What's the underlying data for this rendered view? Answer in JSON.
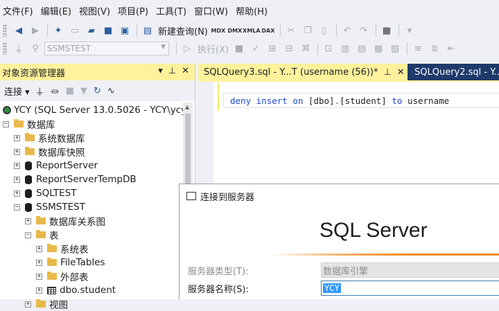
{
  "menubar": {
    "items": [
      "文件(F)",
      "编辑(E)",
      "视图(V)",
      "项目(P)",
      "工具(T)",
      "窗口(W)",
      "帮助(H)"
    ]
  },
  "toolbar": {
    "new_query_label": "新建查询(N)",
    "small_buttons": [
      "MDX",
      "DMX",
      "XMLA",
      "DAX"
    ],
    "database_combo_value": "SSMSTEST",
    "execute_label": "执行(X)"
  },
  "object_explorer": {
    "title": "对象资源管理器",
    "connect_label": "连接",
    "server_node": "YCY (SQL Server 13.0.5026 - YCY\\ycy",
    "databases_node": "数据库",
    "nodes": [
      {
        "label": "系统数据库",
        "icon": "folder-icon"
      },
      {
        "label": "数据库快照",
        "icon": "folder-icon"
      },
      {
        "label": "ReportServer",
        "icon": "database-icon"
      },
      {
        "label": "ReportServerTempDB",
        "icon": "database-icon"
      },
      {
        "label": "SQLTEST",
        "icon": "database-icon"
      },
      {
        "label": "SSMSTEST",
        "icon": "database-icon"
      },
      {
        "label": "数据库关系图",
        "icon": "folder-icon"
      },
      {
        "label": "表",
        "icon": "folder-icon"
      },
      {
        "label": "系统表",
        "icon": "folder-icon"
      },
      {
        "label": "FileTables",
        "icon": "folder-icon"
      },
      {
        "label": "外部表",
        "icon": "folder-icon"
      },
      {
        "label": "dbo.student",
        "icon": "table-icon"
      },
      {
        "label": "视图",
        "icon": "folder-icon"
      }
    ]
  },
  "editor": {
    "tabs": [
      {
        "label": "SQLQuery3.sql - Y...T (username (56))*",
        "active": true
      },
      {
        "label": "SQLQuery2.sql - Y...",
        "active": false
      }
    ],
    "code": {
      "kw1": "deny",
      "kw2": "insert",
      "kw3": "on",
      "obj1": "[dbo]",
      "dot": ".",
      "obj2": "[student]",
      "kw4": "to",
      "user": "username"
    }
  },
  "connect_dialog": {
    "title": "连接到服务器",
    "product": "SQL Server",
    "server_type_label": "服务器类型(T):",
    "server_type_value": "数据库引擎",
    "server_name_label": "服务器名称(S):",
    "server_name_value": "YCY"
  },
  "colors": {
    "active_tab": "#fff29d",
    "inactive_tab": "#1e3a6a",
    "keyword": "#1d47d1",
    "accent": "#f08a24"
  }
}
